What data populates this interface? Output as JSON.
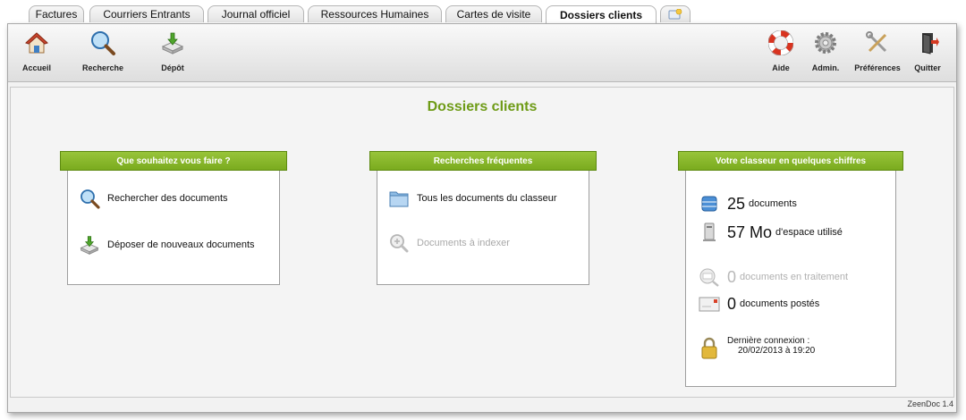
{
  "tabs": [
    {
      "label": "Factures"
    },
    {
      "label": "Courriers Entrants"
    },
    {
      "label": "Journal officiel"
    },
    {
      "label": "Ressources Humaines"
    },
    {
      "label": "Cartes de visite"
    },
    {
      "label": "Dossiers clients"
    }
  ],
  "toolbar": {
    "left": [
      {
        "label": "Accueil",
        "icon": "home-icon"
      },
      {
        "label": "Recherche",
        "icon": "magnifier-icon"
      },
      {
        "label": "Dépôt",
        "icon": "deposit-icon"
      }
    ],
    "right": [
      {
        "label": "Aide",
        "icon": "lifebuoy-icon"
      },
      {
        "label": "Admin.",
        "icon": "gear-icon"
      },
      {
        "label": "Préférences",
        "icon": "tools-icon"
      },
      {
        "label": "Quitter",
        "icon": "exit-door-icon"
      }
    ]
  },
  "page": {
    "title": "Dossiers clients"
  },
  "panels": {
    "actions": {
      "title": "Que souhaitez vous faire ?",
      "items": [
        {
          "label": "Rechercher des documents",
          "icon": "magnifier-icon"
        },
        {
          "label": "Déposer de nouveaux documents",
          "icon": "deposit-icon"
        }
      ]
    },
    "searches": {
      "title": "Recherches fréquentes",
      "items": [
        {
          "label": "Tous les documents du classeur",
          "icon": "folder-icon",
          "enabled": true
        },
        {
          "label": "Documents à indexer",
          "icon": "zoom-icon",
          "enabled": false
        }
      ]
    },
    "stats": {
      "title": "Votre classeur en quelques chiffres",
      "documents": {
        "value": "25",
        "unit": "documents"
      },
      "space": {
        "value": "57 Mo",
        "unit": "d'espace utilisé"
      },
      "processing": {
        "value": "0",
        "unit": "documents en traitement"
      },
      "posted": {
        "value": "0",
        "unit": "documents postés"
      },
      "last_login": {
        "label": "Dernière connexion :",
        "value": "20/02/2013 à 19:20"
      }
    }
  },
  "footer": {
    "version": "ZeenDoc 1.4"
  },
  "colors": {
    "accent": "#7aab1e",
    "title": "#6e9b16"
  }
}
